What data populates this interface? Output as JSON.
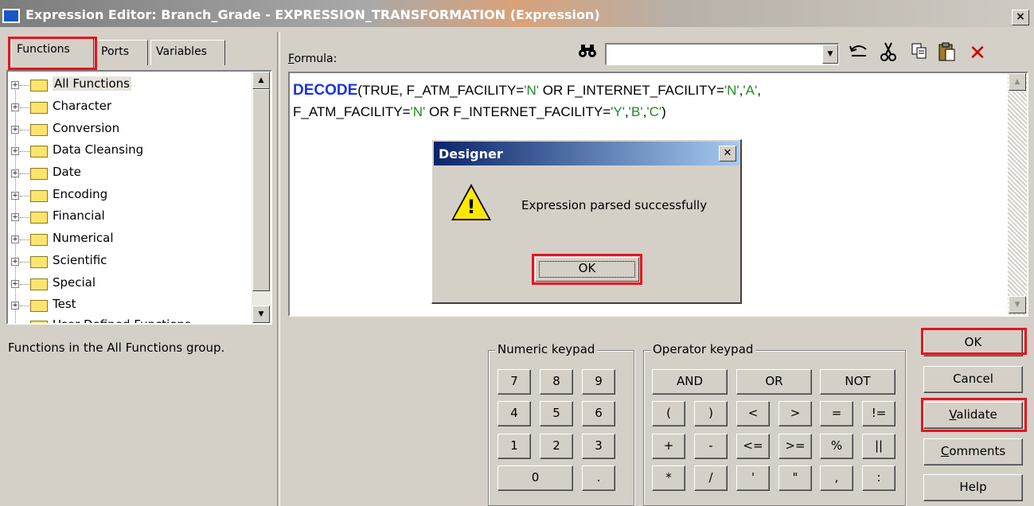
{
  "window": {
    "title": "Expression Editor: Branch_Grade - EXPRESSION_TRANSFORMATION (Expression)",
    "close_label": "×"
  },
  "tabs": [
    {
      "label": "Functions"
    },
    {
      "label": "Ports"
    },
    {
      "label": "Variables"
    }
  ],
  "function_tree": [
    {
      "label": "All Functions"
    },
    {
      "label": "Character"
    },
    {
      "label": "Conversion"
    },
    {
      "label": "Data Cleansing"
    },
    {
      "label": "Date"
    },
    {
      "label": "Encoding"
    },
    {
      "label": "Financial"
    },
    {
      "label": "Numerical"
    },
    {
      "label": "Scientific"
    },
    {
      "label": "Special"
    },
    {
      "label": "Test"
    },
    {
      "label": "User Defined Functions"
    }
  ],
  "tree_description": "Functions in the All Functions group.",
  "formula": {
    "label": "Formula:",
    "line1": {
      "keyword": "DECODE",
      "a": "(TRUE, F_ATM_FACILITY=",
      "s1": "'N'",
      "b": " OR F_INTERNET_FACILITY=",
      "s2": "'N'",
      "c": ",",
      "s3": "'A'",
      "d": ","
    },
    "line2": {
      "a": "F_ATM_FACILITY=",
      "s1": "'N'",
      "b": " OR F_INTERNET_FACILITY=",
      "s2": "'Y'",
      "c": ",",
      "s3": "'B'",
      "d": ",",
      "s4": "'C'",
      "e": ")"
    }
  },
  "toolbar": {
    "search_value": "",
    "find_icon": "binoculars-icon",
    "undo_icon": "undo-icon",
    "cut_icon": "scissors-icon",
    "copy_icon": "copy-icon",
    "paste_icon": "paste-icon",
    "delete_icon": "delete-x-icon",
    "delete_color": "#cc0000"
  },
  "dialog": {
    "title": "Designer",
    "message": "Expression parsed successfully",
    "ok_label": "OK",
    "icon": "warning-icon"
  },
  "numeric_keypad": {
    "title": "Numeric keypad",
    "rows": [
      [
        "7",
        "8",
        "9"
      ],
      [
        "4",
        "5",
        "6"
      ],
      [
        "1",
        "2",
        "3"
      ],
      [
        "0",
        "."
      ]
    ]
  },
  "operator_keypad": {
    "title": "Operator keypad",
    "row1": [
      "AND",
      "OR",
      "NOT"
    ],
    "rows": [
      [
        "(",
        ")",
        "<",
        ">",
        "=",
        "!="
      ],
      [
        "+",
        "-",
        "<=",
        ">=",
        "%",
        "||"
      ],
      [
        "*",
        "/",
        "'",
        "\"",
        ",",
        ":"
      ]
    ]
  },
  "buttons": {
    "ok": "OK",
    "cancel": "Cancel",
    "validate_underline": "V",
    "validate_rest": "alidate",
    "comments_underline": "C",
    "comments_rest": "omments",
    "help": "Help"
  },
  "highlight_color": "#e8131f"
}
